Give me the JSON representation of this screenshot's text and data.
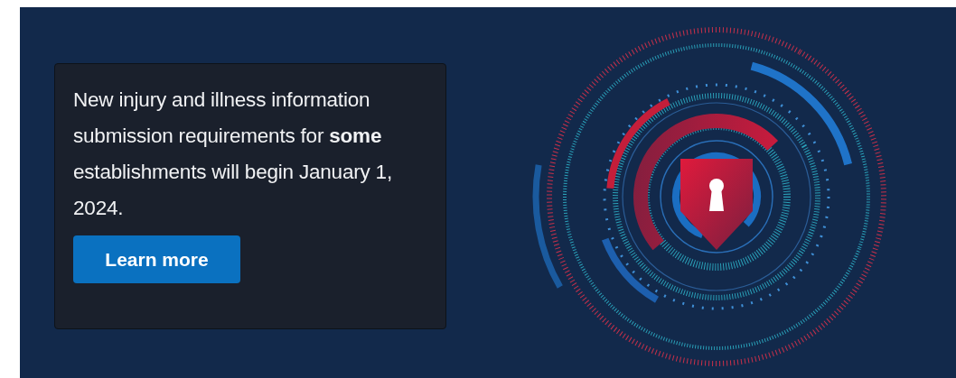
{
  "banner": {
    "message": "New injury and illness information submission requirements for **some** establishments will begin January 1, 2024.",
    "button": "Learn more"
  }
}
